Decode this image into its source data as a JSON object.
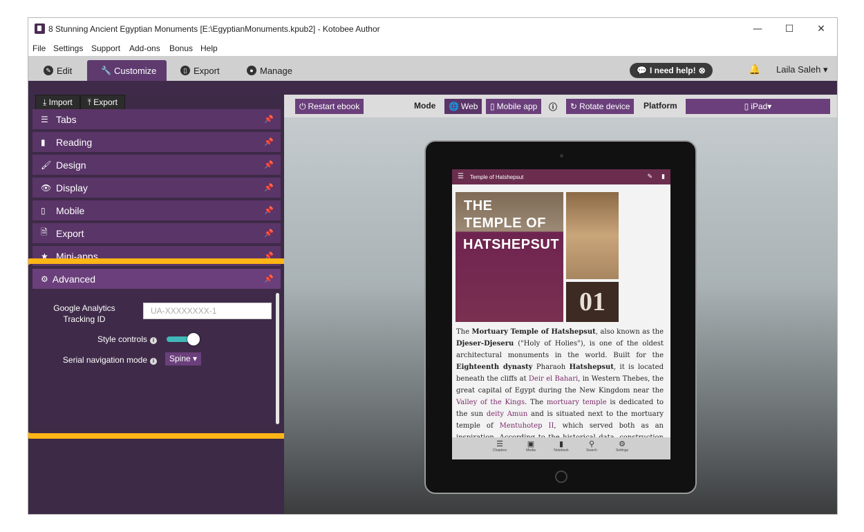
{
  "window": {
    "title": "8 Stunning Ancient Egyptian Monuments [E:\\EgyptianMonuments.kpub2] - Kotobee Author",
    "minimize": "—",
    "maximize": "☐",
    "close": "✕"
  },
  "menu": [
    "File",
    "Settings",
    "Support",
    "Add-ons",
    "Bonus",
    "Help"
  ],
  "tabs": [
    {
      "label": "Edit"
    },
    {
      "label": "Customize"
    },
    {
      "label": "Export"
    },
    {
      "label": "Manage"
    }
  ],
  "help_button": "I need help!",
  "user_name": "Laila Saleh",
  "sidebar": {
    "import_label": "Import",
    "export_label": "Export",
    "panels": [
      "Tabs",
      "Reading",
      "Design",
      "Display",
      "Mobile",
      "Export",
      "Mini-apps"
    ],
    "advanced": {
      "title": "Advanced",
      "ga_label_line1": "Google Analytics",
      "ga_label_line2": "Tracking ID",
      "ga_placeholder": "UA-XXXXXXXX-1",
      "style_controls_label": "Style controls",
      "style_controls_on": true,
      "serial_nav_label": "Serial navigation mode",
      "serial_nav_value": "Spine"
    }
  },
  "preview_toolbar": {
    "restart_label": "Restart ebook",
    "mode_label": "Mode",
    "web_label": "Web",
    "mobile_label": "Mobile app",
    "rotate_label": "Rotate device",
    "platform_label": "Platform",
    "platform_value": "iPad"
  },
  "ebook": {
    "header_title": "Temple of Hatshepsut",
    "hero_line1": "THE",
    "hero_line2": "TEMPLE OF",
    "hero_line3": "HATSHEPSUT",
    "chapter_number": "01",
    "footer": [
      "Chapters",
      "Media",
      "Notebook",
      "Search",
      "Settings"
    ]
  },
  "colors": {
    "accent": "#6a3f7b",
    "highlight": "#ffb515",
    "toggle_on": "#41b8b8"
  }
}
